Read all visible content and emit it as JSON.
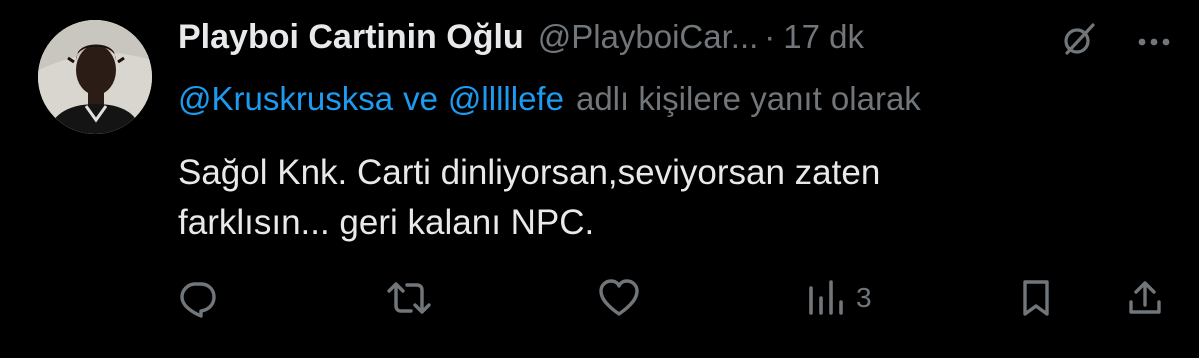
{
  "tweet": {
    "display_name": "Playboi Cartinin Oğlu",
    "handle": "@PlayboiCar...",
    "separator": "·",
    "time": "17 dk",
    "reply_to": {
      "mention1": "@Kruskrusksa",
      "conjunction": "ve",
      "mention2": "@lllllefe",
      "suffix": "adlı kişilere yanıt olarak"
    },
    "text_lines": [
      "Sağol Knk. Carti dinliyorsan,seviyorsan zaten",
      "farklısın... geri kalanı NPC."
    ]
  },
  "actions": {
    "views_count": "3"
  },
  "icons": {
    "avatar": "avatar-photo",
    "grok": "grok-icon",
    "more": "more-icon",
    "reply": "reply-icon",
    "retweet": "retweet-icon",
    "like": "heart-icon",
    "views": "views-icon",
    "bookmark": "bookmark-icon",
    "share": "share-icon"
  },
  "colors": {
    "background": "#000000",
    "text": "#e7e9ea",
    "secondary": "#71767b",
    "accent": "#1d9bf0"
  }
}
